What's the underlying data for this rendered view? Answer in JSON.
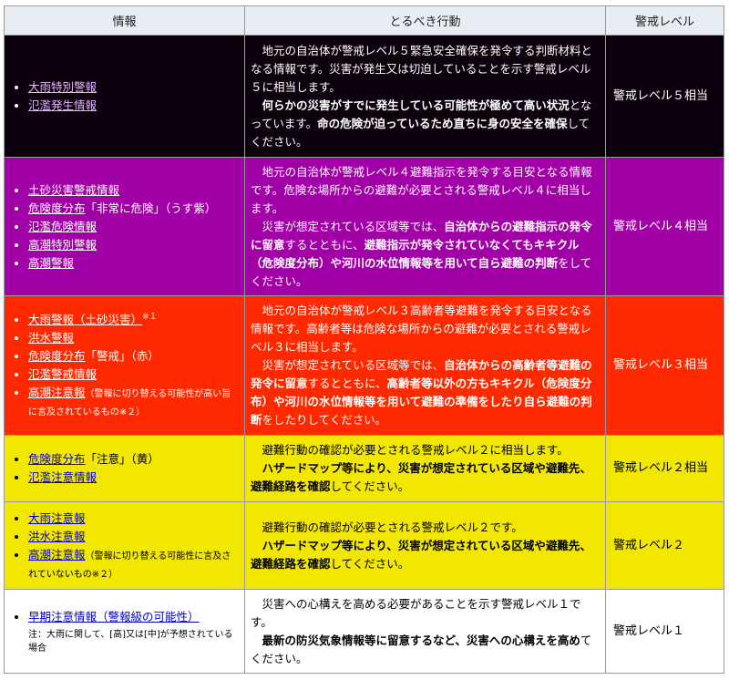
{
  "headers": {
    "info": "情報",
    "action": "とるべき行動",
    "level": "警戒レベル"
  },
  "rows": [
    {
      "bg": "#0c000c",
      "items": [
        "大雨特別警報",
        "氾濫発生情報"
      ],
      "action": {
        "p1": "地元の自治体が警戒レベル５緊急安全確保を発令する判断材料となる情報です。災害が発生又は切迫していることを示す警戒レベル５に相当します。",
        "p2_bold1": "何らかの災害がすでに発生している可能性が極めて高い状況",
        "p2_text1": "となっています。",
        "p2_bold2": "命の危険が迫っているため直ちに身の安全を確保",
        "p2_text2": "してください。"
      },
      "level": "警戒レベル５相当"
    },
    {
      "bg": "#a100a6",
      "items": [
        "土砂災害警戒情報",
        "危険度分布",
        "氾濫危険情報",
        "高潮特別警報",
        "高潮警報"
      ],
      "item2_suffix": "「非常に危険」（うす紫）",
      "action": {
        "p1": "地元の自治体が警戒レベル４避難指示を発令する目安となる情報です。危険な場所からの避難が必要とされる警戒レベル４に相当します。",
        "p2_text1": "災害が想定されている区域等では、",
        "p2_bold1": "自治体からの避難指示の発令に留意",
        "p2_text2": "するとともに、",
        "p2_bold2": "避難指示が発令されていなくてもキキクル（危険度分布）や河川の水位情報等を用いて自ら避難の判断",
        "p2_text3": "をしてください。"
      },
      "level": "警戒レベル４相当"
    },
    {
      "bg": "#ff2900",
      "items": [
        "大雨警報（土砂災害）",
        "洪水警報",
        "危険度分布",
        "氾濫警戒情報",
        "高潮注意報"
      ],
      "item1_sup": "※１",
      "item3_suffix": "「警戒」（赤）",
      "item5_suffix": "（警報に切り替える可能性が高い旨に言及されているもの※２）",
      "action": {
        "p1": "地元の自治体が警戒レベル３高齢者等避難を発令する目安となる情報です。高齢者等は危険な場所からの避難が必要とされる警戒レベル３に相当します。",
        "p2_text1": "災害が想定されている区域等では、",
        "p2_bold1": "自治体からの高齢者等避難の発令に留意",
        "p2_text2": "するとともに、",
        "p2_bold2": "高齢者等以外の方もキキクル（危険度分布）や河川の水位情報等を用いて避難の準備をしたり自ら避難の判断",
        "p2_text3": "をしたりしてください。"
      },
      "level": "警戒レベル３相当"
    },
    {
      "bg": "#f2e700",
      "items": [
        "危険度分布",
        "氾濫注意情報"
      ],
      "item1_suffix": "「注意」（黄）",
      "action": {
        "p1": "避難行動の確認が必要とされる警戒レベル２に相当します。",
        "p2_bold1": "ハザードマップ等により、災害が想定されている区域や避難先、避難経路を確認",
        "p2_text1": "してください。"
      },
      "level": "警戒レベル２相当"
    },
    {
      "bg": "#f2e700",
      "items": [
        "大雨注意報",
        "洪水注意報",
        "高潮注意報"
      ],
      "item3_suffix": "（警報に切り替える可能性に言及されていないもの※２）",
      "action": {
        "p1": "避難行動の確認が必要とされる警戒レベル２です。",
        "p2_bold1": "ハザードマップ等により、災害が想定されている区域や避難先、避難経路を確認",
        "p2_text1": "してください。"
      },
      "level": "警戒レベル２"
    },
    {
      "bg": "#ffffff",
      "items": [
        "早期注意情報（警報級の可能性）"
      ],
      "note": "注：大雨に関して、[高]又は[中]が予想されている場合",
      "action": {
        "p1": "災害への心構えを高める必要があることを示す警戒レベル１です。",
        "p2_bold1": "最新の防災気象情報等に留意するなど、災害への心構えを高め",
        "p2_text1": "てください。"
      },
      "level": "警戒レベル１"
    }
  ]
}
